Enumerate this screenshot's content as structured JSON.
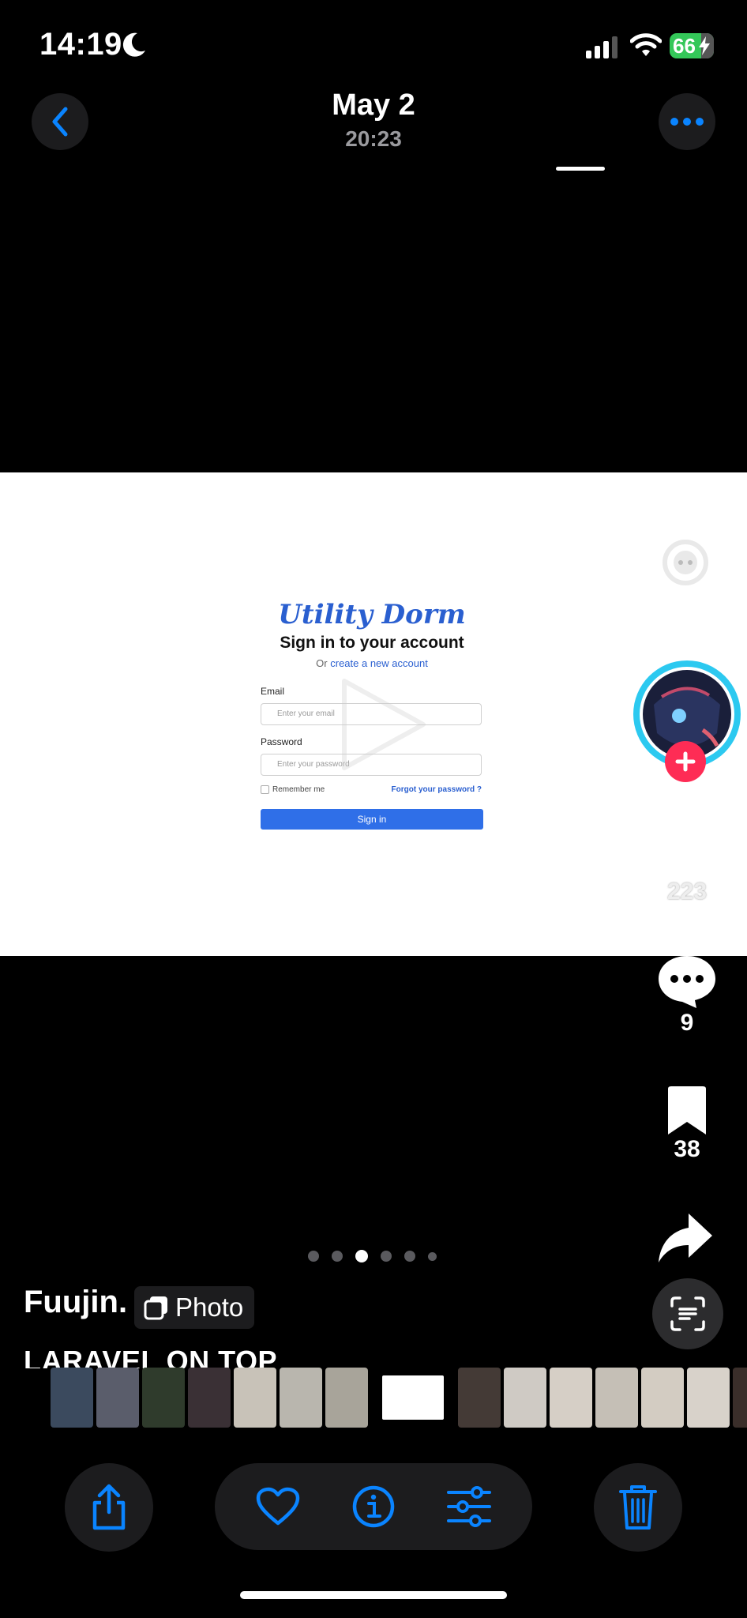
{
  "status_bar": {
    "time": "14:19",
    "battery": "66"
  },
  "header": {
    "date": "May 2",
    "time": "20:23"
  },
  "photo": {
    "brand": "Utility Dorm",
    "title": "Sign in to your account",
    "subtitle_prefix": "Or ",
    "subtitle_link": "create a new account",
    "email_label": "Email",
    "email_placeholder": "Enter your email",
    "password_label": "Password",
    "password_placeholder": "Enter your password",
    "remember_label": "Remember me",
    "forgot_label": "Forgot your password ?",
    "signin_button": "Sign in"
  },
  "rail": {
    "likes": "223",
    "comments": "9",
    "saves": "38"
  },
  "post": {
    "author": "Fuujin.",
    "badge": "Photo",
    "caption": "LARAVEL ON TOP"
  },
  "carousel": {
    "page_count": 6,
    "active_index": 2
  },
  "filmstrip_colors": [
    "#3b4a5e",
    "#5a5d6b",
    "#2f3b2c",
    "#3a3035",
    "#c8c2b8",
    "#b9b6ae",
    "#a8a49a",
    "#ffffff",
    "#443a36",
    "#cfcac4",
    "#d6cfc6",
    "#c5bfb6",
    "#d3ccc2",
    "#d8d2ca",
    "#3a2e2a"
  ],
  "colors": {
    "accent": "#0a84ff",
    "follow": "#fe2c55",
    "battery": "#34c759"
  }
}
